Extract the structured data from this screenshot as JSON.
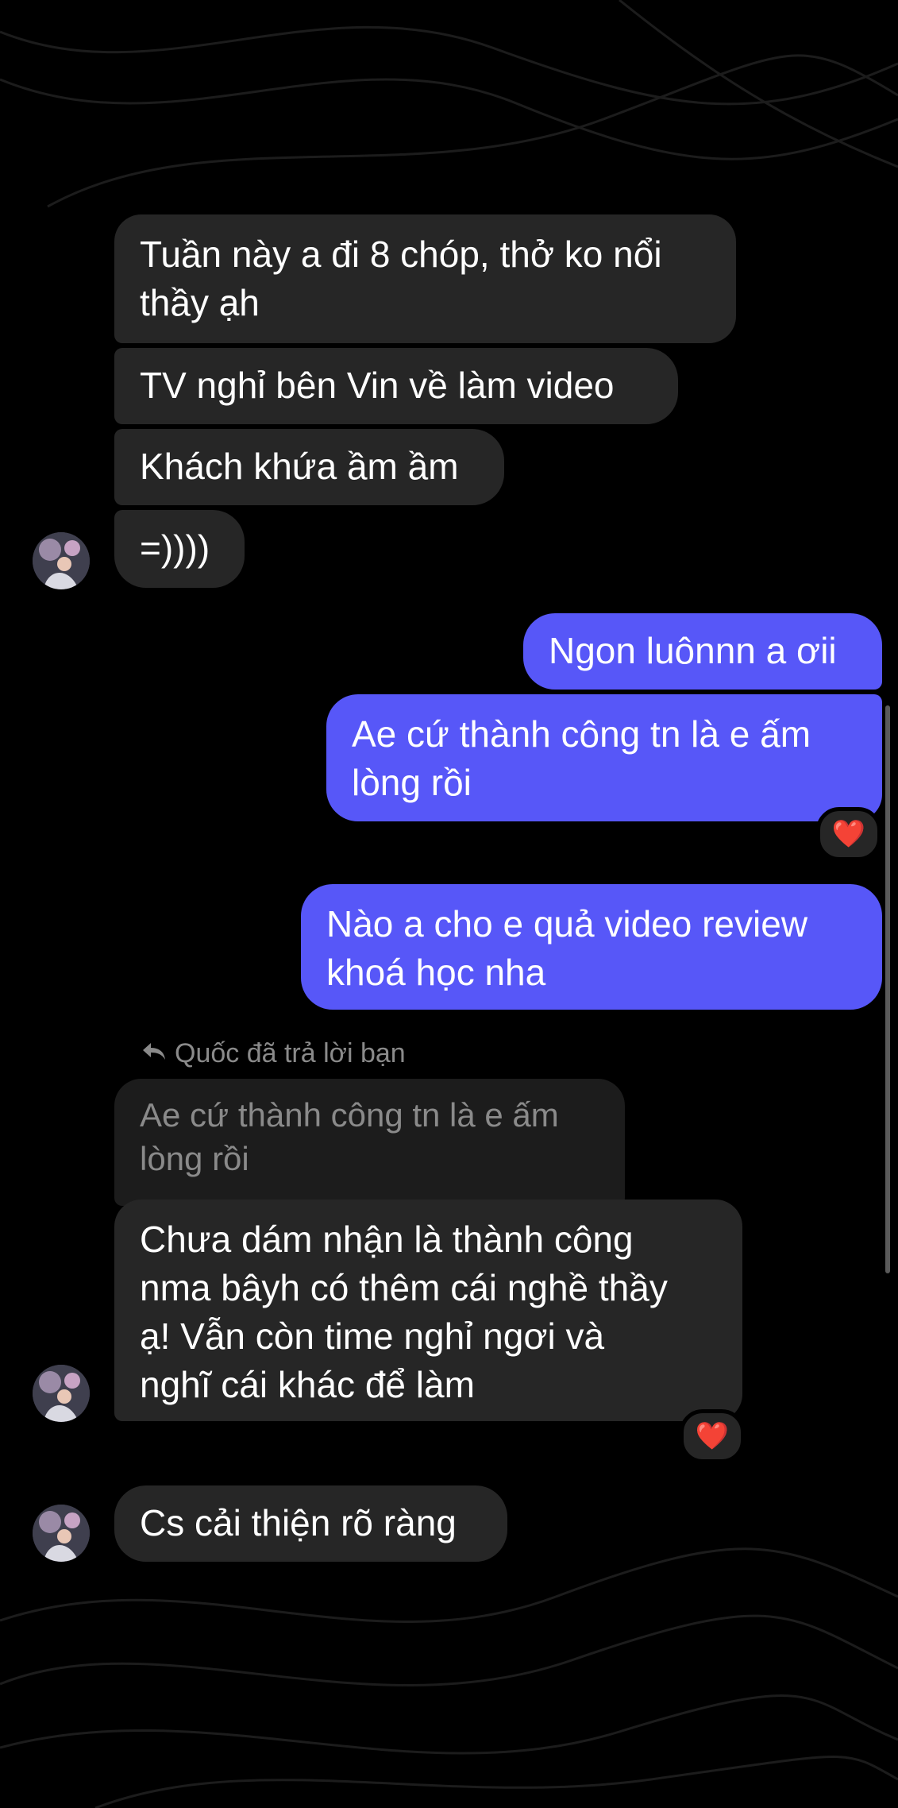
{
  "colors": {
    "background": "#000000",
    "incoming_bubble": "#262626",
    "outgoing_bubble": "#5757f8",
    "quoted_bubble": "#1c1c1c",
    "reaction": "#ff2d44"
  },
  "messages": {
    "m1": "Tuần này a đi 8 chóp, thở ko nổi\nthầy ạh",
    "m2": "TV nghỉ bên Vin về làm video",
    "m3": "Khách khứa ầm ầm",
    "m4": "=))))",
    "m5": "Ngon luônnn a ơii",
    "m6": "Ae cứ thành công tn là e ấm\nlòng rồi",
    "m7": "Nào a cho e quả video review\nkhoá học nha",
    "reply_label": "Quốc đã trả lời bạn",
    "quoted": "Ae cứ thành công tn là e ấm\nlòng rồi",
    "m8": "Chưa dám nhận là thành công\nnma bâyh có thêm cái nghề thầy\nạ! Vẫn còn time nghỉ ngơi và\nnghĩ cái khác để làm",
    "m9": "Cs cải thiện rõ ràng"
  },
  "reactions": {
    "r1": "❤️",
    "r2": "❤️"
  },
  "icons": {
    "reply": "reply-arrow-icon",
    "reaction": "heart-icon",
    "avatar": "contact-avatar"
  }
}
